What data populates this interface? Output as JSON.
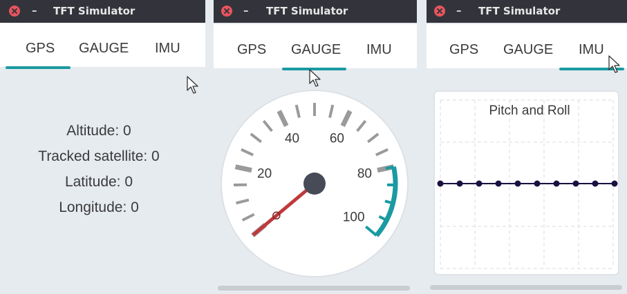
{
  "windows": [
    {
      "title": "TFT Simulator",
      "minimize": "–",
      "tabs": [
        "GPS",
        "GAUGE",
        "IMU"
      ],
      "active_tab": "GPS"
    },
    {
      "title": "TFT Simulator",
      "minimize": "–",
      "tabs": [
        "GPS",
        "GAUGE",
        "IMU"
      ],
      "active_tab": "GAUGE"
    },
    {
      "title": "TFT Simulator",
      "minimize": "–",
      "tabs": [
        "GPS",
        "GAUGE",
        "IMU"
      ],
      "active_tab": "IMU"
    }
  ],
  "gps": {
    "altitude": "Altitude: 0",
    "satellites": "Tracked satellite: 0",
    "latitude": "Latitude: 0",
    "longitude": "Longitude: 0"
  },
  "gauge": {
    "min": 0,
    "max": 100,
    "value": 0,
    "labels": [
      "20",
      "40",
      "60",
      "80",
      "100"
    ],
    "needle_color": "#c0393b",
    "accent_color": "#1a9aa2"
  },
  "imu": {
    "chart_title": "Pitch and Roll"
  },
  "chart_data": {
    "type": "line",
    "title": "Pitch and Roll",
    "x": [
      1,
      2,
      3,
      4,
      5,
      6,
      7,
      8,
      9,
      10
    ],
    "series": [
      {
        "values": [
          0,
          0,
          0,
          0,
          0,
          0,
          0,
          0,
          0,
          0
        ]
      }
    ],
    "grid": true,
    "line_color": "#1a1040"
  },
  "colors": {
    "titlebar": "#33343b",
    "close_button": "#e9545e",
    "accent": "#1a9aa2",
    "content_bg": "#e6ebf0"
  }
}
